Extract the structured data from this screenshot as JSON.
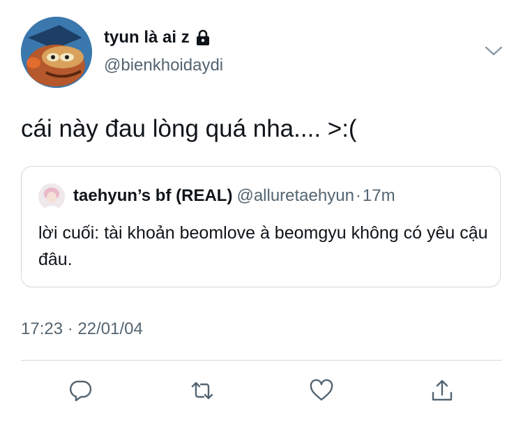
{
  "author": {
    "display_name": "tyun là ai z",
    "handle": "@bienkhoidaydi",
    "avatar_icon": "avatar-cartoon-fish-icon",
    "protected_icon": "lock-icon"
  },
  "tweet": {
    "text": "cái này đau lòng quá nha.... >:(",
    "timestamp": "17:23 · 22/01/04"
  },
  "quoted_tweet": {
    "display_name": "taehyun’s bf (REAL)",
    "handle": "@alluretaehyun",
    "separator": "·",
    "time": "17m",
    "text": "lời cuối: tài khoản beomlove à beomgyu không có yêu cậu đâu."
  },
  "actions": [
    "reply-icon",
    "retweet-icon",
    "like-icon",
    "share-icon"
  ],
  "colors": {
    "primary_text": "#0f1419",
    "secondary_text": "#536471",
    "border": "#cfd9de"
  }
}
